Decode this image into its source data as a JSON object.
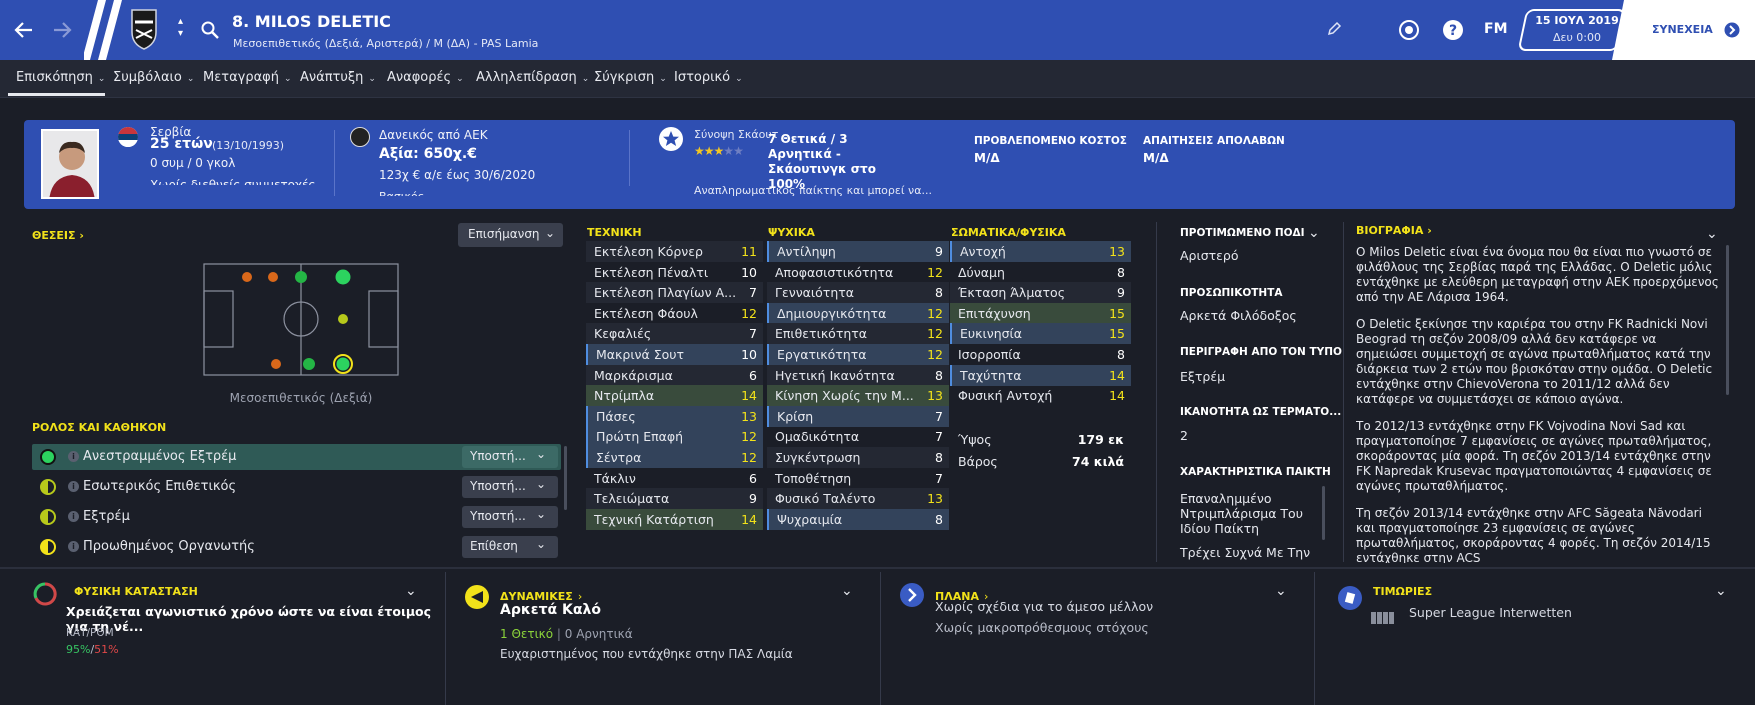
{
  "header": {
    "name": "8. MILOS DELETIC",
    "subtitle": "Μεσοεπιθετικός (Δεξιά, Αριστερά) / Μ (ΔΑ) - PAS Lamia",
    "date": "15 ΙΟΥΛ 2019",
    "time": "Δευ 0:00",
    "continue_label": "ΣΥΝΕΧΕΙΑ",
    "fm_label": "FM"
  },
  "nav": [
    "Επισκόπηση",
    "Συμβόλαιο",
    "Μεταγραφή",
    "Ανάπτυξη",
    "Αναφορές",
    "Αλληλεπίδραση",
    "Σύγκριση",
    "Ιστορικό"
  ],
  "overview": {
    "nation": "Σερβία",
    "age": "25 ετών",
    "dob": "(13/10/1993)",
    "caps": "0 συμ / 0 γκολ",
    "intl": "Χωρίς διεθνείς συμμετοχές με",
    "loan": "Δανεικός από ΑΕΚ",
    "value": "Αξία: 650χ.€",
    "wage": "123χ € α/ε έως 30/6/2020",
    "wage2": "Βασικός",
    "scout_title": "Σύνοψη Σκάουτ",
    "scout_summary": "7 Θετικά / 3 Αρνητικά - Σκάουτινγκ στο 100%",
    "scout_desc": "Αναπληρωματικός παίκτης και μπορεί να...",
    "stars": 2.5,
    "cost_label": "ΠΡΟΒΛΕΠΟΜΕΝΟ ΚΟΣΤΟΣ",
    "cost_value": "Μ/Δ",
    "wage_label": "ΑΠΑΙΤΗΣΕΙΣ ΑΠΟΛΑΒΩΝ",
    "wage_value": "Μ/Δ"
  },
  "positions": {
    "title": "ΘΕΣΕΙΣ",
    "dropdown": "Επισήμανση",
    "caption": "Μεσοεπιθετικός (Δεξιά)"
  },
  "roles": {
    "title": "ΡΟΛΟΣ ΚΑΙ ΚΑΘΗΚΟΝ",
    "items": [
      {
        "name": "Ανεστραμμένος Εξτρέμ",
        "duty": "Υποστή..."
      },
      {
        "name": "Εσωτερικός Επιθετικός",
        "duty": "Υποστή..."
      },
      {
        "name": "Εξτρέμ",
        "duty": "Υποστή..."
      },
      {
        "name": "Προωθημένος Οργανωτής",
        "duty": "Επίθεση"
      }
    ]
  },
  "technical": {
    "title": "ΤΕΧΝΙΚΗ",
    "rows": [
      {
        "n": "Εκτέλεση Κόρνερ",
        "v": "11"
      },
      {
        "n": "Εκτέλεση Πέναλτι",
        "v": "10"
      },
      {
        "n": "Εκτέλεση Πλαγίων Α...",
        "v": "7"
      },
      {
        "n": "Εκτέλεση Φάουλ",
        "v": "12"
      },
      {
        "n": "Κεφαλιές",
        "v": "7"
      },
      {
        "n": "Μακρινά Σουτ",
        "v": "10"
      },
      {
        "n": "Μαρκάρισμα",
        "v": "6"
      },
      {
        "n": "Ντρίμπλα",
        "v": "14"
      },
      {
        "n": "Πάσες",
        "v": "13"
      },
      {
        "n": "Πρώτη Επαφή",
        "v": "12"
      },
      {
        "n": "Σέντρα",
        "v": "12"
      },
      {
        "n": "Τάκλιν",
        "v": "6"
      },
      {
        "n": "Τελειώματα",
        "v": "9"
      },
      {
        "n": "Τεχνική Κατάρτιση",
        "v": "14"
      }
    ]
  },
  "mental": {
    "title": "ΨΥΧΙΚΑ",
    "rows": [
      {
        "n": "Αντίληψη",
        "v": "9"
      },
      {
        "n": "Αποφασιστικότητα",
        "v": "12"
      },
      {
        "n": "Γενναιότητα",
        "v": "8"
      },
      {
        "n": "Δημιουργικότητα",
        "v": "12"
      },
      {
        "n": "Επιθετικότητα",
        "v": "12"
      },
      {
        "n": "Εργατικότητα",
        "v": "12"
      },
      {
        "n": "Ηγετική Ικανότητα",
        "v": "8"
      },
      {
        "n": "Κίνηση Χωρίς την Μ...",
        "v": "13"
      },
      {
        "n": "Κρίση",
        "v": "7"
      },
      {
        "n": "Ομαδικότητα",
        "v": "7"
      },
      {
        "n": "Συγκέντρωση",
        "v": "8"
      },
      {
        "n": "Τοποθέτηση",
        "v": "7"
      },
      {
        "n": "Φυσικό Ταλέντο",
        "v": "13"
      },
      {
        "n": "Ψυχραιμία",
        "v": "8"
      }
    ]
  },
  "physical": {
    "title": "ΣΩΜΑΤΙΚΑ/ΦΥΣΙΚΑ",
    "rows": [
      {
        "n": "Αντοχή",
        "v": "13"
      },
      {
        "n": "Δύναμη",
        "v": "8"
      },
      {
        "n": "Έκταση Άλματος",
        "v": "9"
      },
      {
        "n": "Επιτάχυνση",
        "v": "15"
      },
      {
        "n": "Ευκινησία",
        "v": "15"
      },
      {
        "n": "Ισορροπία",
        "v": "8"
      },
      {
        "n": "Ταχύτητα",
        "v": "14"
      },
      {
        "n": "Φυσική Αντοχή",
        "v": "14"
      }
    ],
    "height_label": "Ύψος",
    "height": "179 εκ",
    "weight_label": "Βάρος",
    "weight": "74 κιλά"
  },
  "details": {
    "foot_label": "ΠΡΟΤΙΜΩΜΕΝΟ ΠΟΔΙ",
    "foot": "Αριστερό",
    "personality_label": "ΠΡΟΣΩΠΙΚΟΤΗΤΑ",
    "personality": "Αρκετά Φιλόδοξος",
    "media_label": "ΠΕΡΙΓΡΑΦΗ ΑΠΟ ΤΟΝ ΤΥΠΟ",
    "media": "Εξτρέμ",
    "finishing_label": "ΙΚΑΝΟΤΗΤΑ ΩΣ ΤΕΡΜΑΤΟ...",
    "finishing": "2",
    "traits_label": "ΧΑΡΑΚΤΗΡΙΣΤΙΚΑ ΠΑΙΚΤΗ",
    "trait1": "Επαναλημμένο Ντριμπλάρισμα Του Ιδίου Παίκτη",
    "trait2": "Τρέχει Συχνά Με Την"
  },
  "bio": {
    "title": "ΒΙΟΓΡΑΦΙΑ",
    "p1": "Ο Milos Deletic είναι ένα όνομα που θα είναι πιο γνωστό σε φιλάθλους της Σερβίας παρά της Ελλάδας. Ο Deletic μόλις εντάχθηκε με ελεύθερη μεταγραφή στην ΑΕΚ προερχόμενος από την ΑΕ Λάρισα 1964.",
    "p2": "Ο Deletic ξεκίνησε την καριέρα του στην FK Radnicki Novi Beograd τη σεζόν 2008/09 αλλά δεν κατάφερε να σημειώσει συμμετοχή σε αγώνα πρωταθλήματος κατά την διάρκεια των 2 ετών που βρισκόταν στην ομάδα. Ο Deletic εντάχθηκε στην ChievoVerona το 2011/12 αλλά δεν κατάφερε να συμμετάσχει σε κάποιο αγώνα.",
    "p3": "Το 2012/13 εντάχθηκε στην FK Vojvodina Novi Sad και πραγματοποίησε 7 εμφανίσεις σε αγώνες πρωταθλήματος, σκοράροντας μία φορά. Τη σεζόν 2013/14 εντάχθηκε στην FK Napredak Krusevac πραγματοποιώντας 4 εμφανίσεις σε αγώνες πρωταθλήματος.",
    "p4": "Τη σεζόν 2013/14 εντάχθηκε στην AFC Săgeata Năvodari και πραγματοποίησε 23 εμφανίσεις σε αγώνες πρωταθλήματος, σκοράροντας 4 φορές. Τη σεζόν 2014/15 εντάχθηκε στην ACS"
  },
  "bottom": {
    "fitness_title": "ΦΥΣΙΚΗ ΚΑΤΑΣΤΑΣΗ",
    "fitness_text": "Χρειάζεται αγωνιστικό χρόνο ώστε να είναι έτοιμος για τη νέ...",
    "cond_label": "ΚΑΤ/ΡΘΜ",
    "cond_a": "95%",
    "cond_sep": "/",
    "cond_b": "51%",
    "dyn_title": "ΔΥΝΑΜΙΚΕΣ",
    "dyn_value": "Αρκετά Καλό",
    "dyn_pos": "1 Θετικό",
    "dyn_neg": "0 Αρνητικά",
    "dyn_note": "Ευχαριστημένος που εντάχθηκε στην ΠΑΣ Λαμία",
    "plans_title": "ΠΛΑΝΑ",
    "plans1": "Χωρίς σχέδια για το άμεσο μέλλον",
    "plans2": "Χωρίς μακροπρόθεσμους στόχους",
    "bans_title": "ΤΙΜΩΡΙΕΣ",
    "bans_text": "Super League Interwetten"
  },
  "colors": {
    "accent": "#2f4fb2",
    "yellow": "#f2e21a",
    "green": "#8bd33a"
  }
}
